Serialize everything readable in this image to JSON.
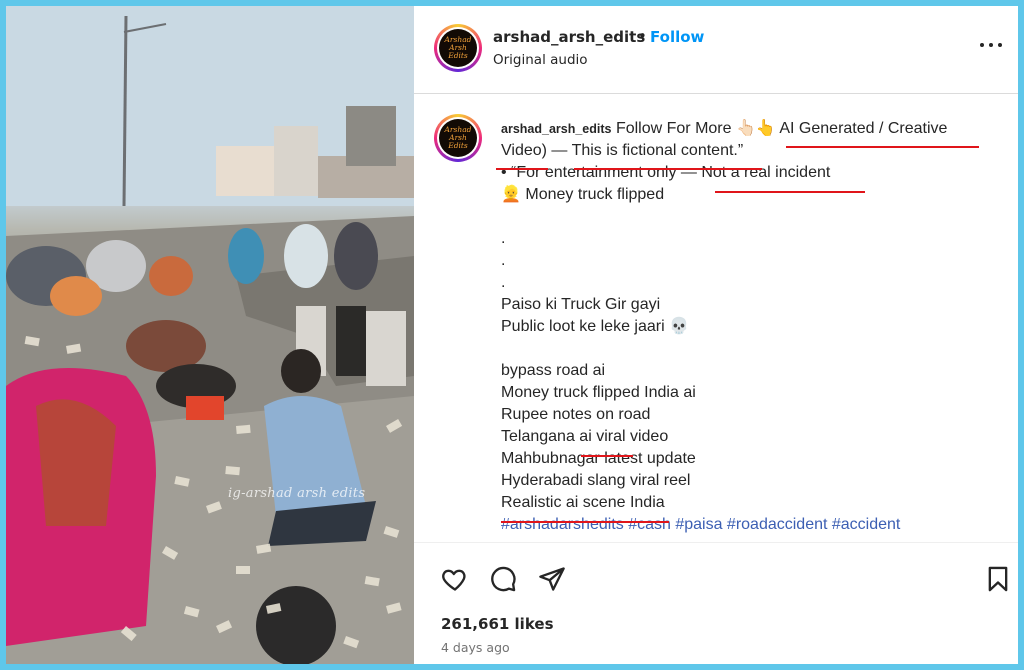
{
  "post": {
    "username": "arshad_arsh_edits",
    "separator": "•",
    "follow_label": "Follow",
    "audio": "Original audio",
    "avatar_text": "Arshad Arsh Edits",
    "watermark": "ig-arshad arsh edits"
  },
  "caption": {
    "username": "arshad_arsh_edits",
    "line1": "Follow For More 👆🏻👆 AI Generated / Creative",
    "line2": "Video) — This is fictional content.”",
    "line3": "• “For entertainment only — Not a real incident",
    "line4": "👱 Money truck flipped",
    "dot1": ".",
    "dot2": ".",
    "dot3": ".",
    "line5": "Paiso ki Truck Gir gayi",
    "line6": "Public loot ke leke jaari 💀",
    "line7": "bypass road ai",
    "line8": "Money truck flipped India ai",
    "line9": "Rupee notes on road",
    "line10": "Telangana ai viral video",
    "line11": "Mahbubnagar latest update",
    "line12": "Hyderabadi slang viral reel",
    "line13": "Realistic ai scene India",
    "hashtags": "#arshadarshedits #cash #paisa #roadaccident #accident"
  },
  "footer": {
    "likes": "261,661 likes",
    "time": "4 days ago"
  },
  "icons": [
    "like-heart-icon",
    "comment-icon",
    "share-icon",
    "save-bookmark-icon",
    "more-options-icon"
  ],
  "colors": {
    "follow": "#0095f6",
    "highlight_underline": "#e0151a",
    "hashtag": "#3c5fb3",
    "border": "#5fc7ea"
  }
}
